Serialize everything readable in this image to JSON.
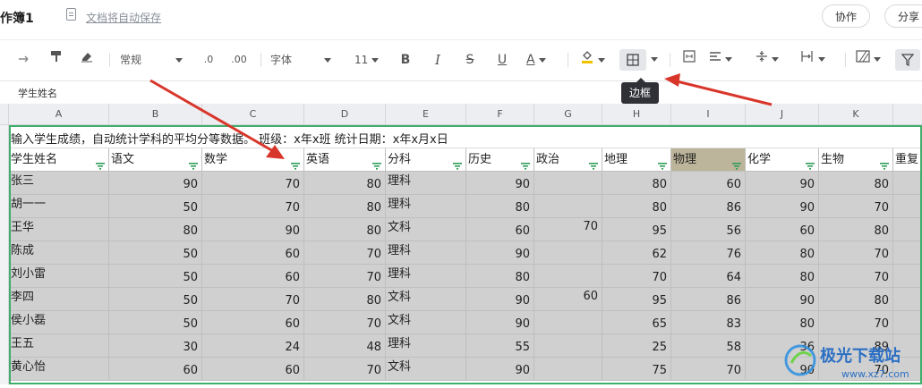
{
  "app": {
    "title": "作簿1",
    "autosave": "文档将自动保存",
    "collab_btn": "协作",
    "share_btn": "分享"
  },
  "toolbar": {
    "format": "常规",
    "dec_minus": ".0",
    "dec_plus": ".00",
    "font": "字体",
    "size": "11",
    "bold": "B",
    "italic": "I",
    "strike": "S",
    "underline": "U",
    "font_color": "A",
    "border_tooltip": "边框",
    "colors": {
      "accent_green": "#3fae6b",
      "arrow_red": "#d9362b",
      "highlight_cell": "#bdb59b"
    }
  },
  "formula_bar": {
    "cell_ref": "学生姓名"
  },
  "sheet": {
    "columns": [
      "A",
      "B",
      "C",
      "D",
      "E",
      "F",
      "G",
      "H",
      "I",
      "J",
      "K"
    ],
    "info_row": "输入学生成绩，自动统计学科的平均分等数据。  班级：x年x班 统计日期：x年x月x日",
    "headers": [
      "学生姓名",
      "语文",
      "数学",
      "英语",
      "分科",
      "历史",
      "政治",
      "地理",
      "物理",
      "化学",
      "生物",
      "重复"
    ],
    "rows": [
      [
        "张三",
        "90",
        "70",
        "80",
        "理科",
        "90",
        "",
        "80",
        "60",
        "90",
        "80"
      ],
      [
        "胡一一",
        "50",
        "70",
        "80",
        "理科",
        "80",
        "",
        "80",
        "86",
        "90",
        "70"
      ],
      [
        "王华",
        "80",
        "90",
        "80",
        "文科",
        "60",
        "70",
        "95",
        "56",
        "60",
        "80"
      ],
      [
        "陈成",
        "50",
        "60",
        "70",
        "理科",
        "90",
        "",
        "62",
        "76",
        "80",
        "70"
      ],
      [
        "刘小雷",
        "50",
        "60",
        "70",
        "理科",
        "80",
        "",
        "70",
        "64",
        "80",
        "70"
      ],
      [
        "李四",
        "50",
        "70",
        "80",
        "文科",
        "90",
        "60",
        "95",
        "86",
        "90",
        "80"
      ],
      [
        "侯小磊",
        "50",
        "60",
        "70",
        "文科",
        "90",
        "",
        "65",
        "83",
        "80",
        "70"
      ],
      [
        "王五",
        "30",
        "24",
        "48",
        "理科",
        "55",
        "",
        "25",
        "58",
        "36",
        "89"
      ],
      [
        "黄心怡",
        "60",
        "60",
        "70",
        "文科",
        "90",
        "",
        "75",
        "70",
        "90",
        "70"
      ]
    ]
  },
  "watermark": {
    "brand": "极光下载站",
    "url": "www.xz7.com"
  }
}
